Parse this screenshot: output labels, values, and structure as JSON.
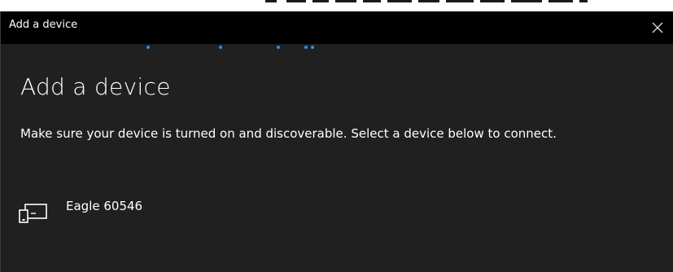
{
  "window": {
    "title": "Add a device",
    "close_icon": "close-icon"
  },
  "progress": {
    "indeterminate": true,
    "accent_color": "#2d8fe6"
  },
  "content": {
    "heading": "Add a device",
    "instructions": "Make sure your device is turned on and discoverable. Select a device below to connect."
  },
  "devices": [
    {
      "name": "Eagle 60546",
      "icon": "display-device-icon"
    }
  ],
  "colors": {
    "dialog_background": "#202020",
    "title_bar_background": "#000000",
    "text": "#ffffff"
  }
}
